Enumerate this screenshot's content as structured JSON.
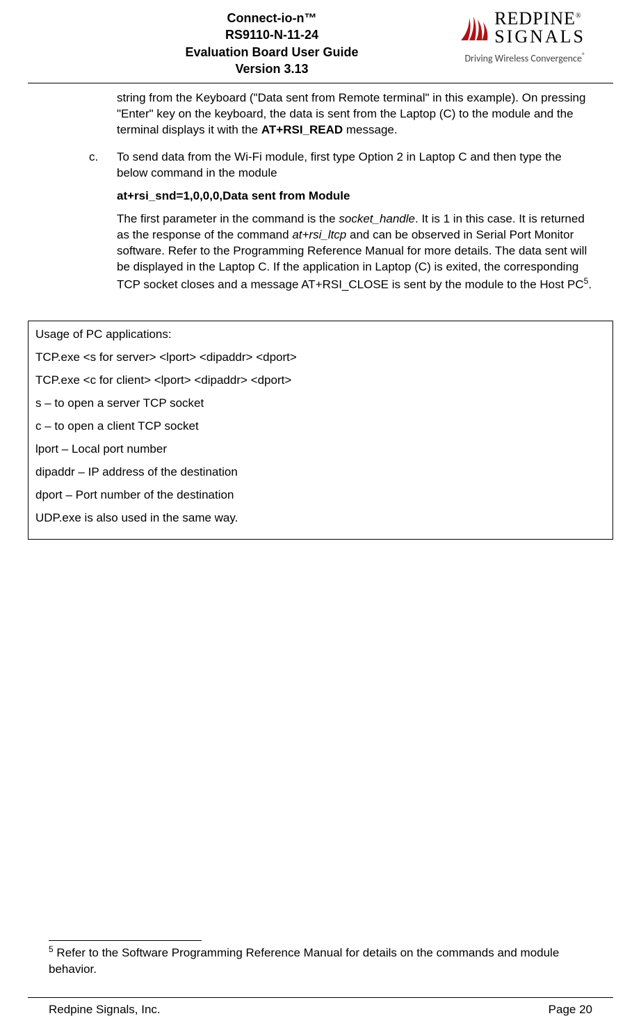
{
  "header": {
    "line1": "Connect-io-n™",
    "line2": "RS9110-N-11-24",
    "line3": "Evaluation Board User Guide",
    "line4": "Version 3.13"
  },
  "logo": {
    "brand_top": "REDPINE",
    "brand_bottom": "SIGNALS",
    "tagline_prefix": "Driving Wireless Convergence",
    "reg": "®"
  },
  "continuation": {
    "text_a": "string from the Keyboard (\"Data sent from Remote terminal\" in this example). On pressing \"Enter\" key on the keyboard, the data is sent from the Laptop (C) to the module and the terminal displays it with the ",
    "bold_a": "AT+RSI_READ",
    "text_b": " message."
  },
  "item_c": {
    "marker": "c.",
    "p1": "To send data from the Wi-Fi module, first type Option 2 in Laptop C and then type the below command in the module",
    "cmd": "at+rsi_snd=1,0,0,0,Data sent from Module",
    "p2_a": "The first parameter in the command is the ",
    "p2_i1": "socket_handle",
    "p2_b": ". It is 1 in this case. It is returned as the response of the command ",
    "p2_i2": "at+rsi_ltcp",
    "p2_c": " and can be observed in Serial Port Monitor software. Refer to the Programming Reference Manual for more details. The data sent will be displayed in the Laptop C. If the application in Laptop (C) is exited, the corresponding TCP socket closes and a message AT+RSI_CLOSE is sent by the module to the Host PC",
    "p2_ref": "5",
    "p2_d": "."
  },
  "usage": {
    "l1": "Usage of PC applications:",
    "l2": "TCP.exe <s for server> <lport> <dipaddr> <dport>",
    "l3": "TCP.exe <c for client> <lport> <dipaddr> <dport>",
    "l4": "s – to open a server TCP socket",
    "l5": "c – to open a client TCP socket",
    "l6": "lport – Local port number",
    "l7": "dipaddr – IP address of the destination",
    "l8": "dport – Port number of the destination",
    "l9": "UDP.exe is also used in the same way."
  },
  "footnote": {
    "ref": "5",
    "text": " Refer to the Software Programming Reference Manual for details on the commands and module behavior."
  },
  "footer": {
    "left": "Redpine Signals, Inc.",
    "right": "Page 20"
  }
}
